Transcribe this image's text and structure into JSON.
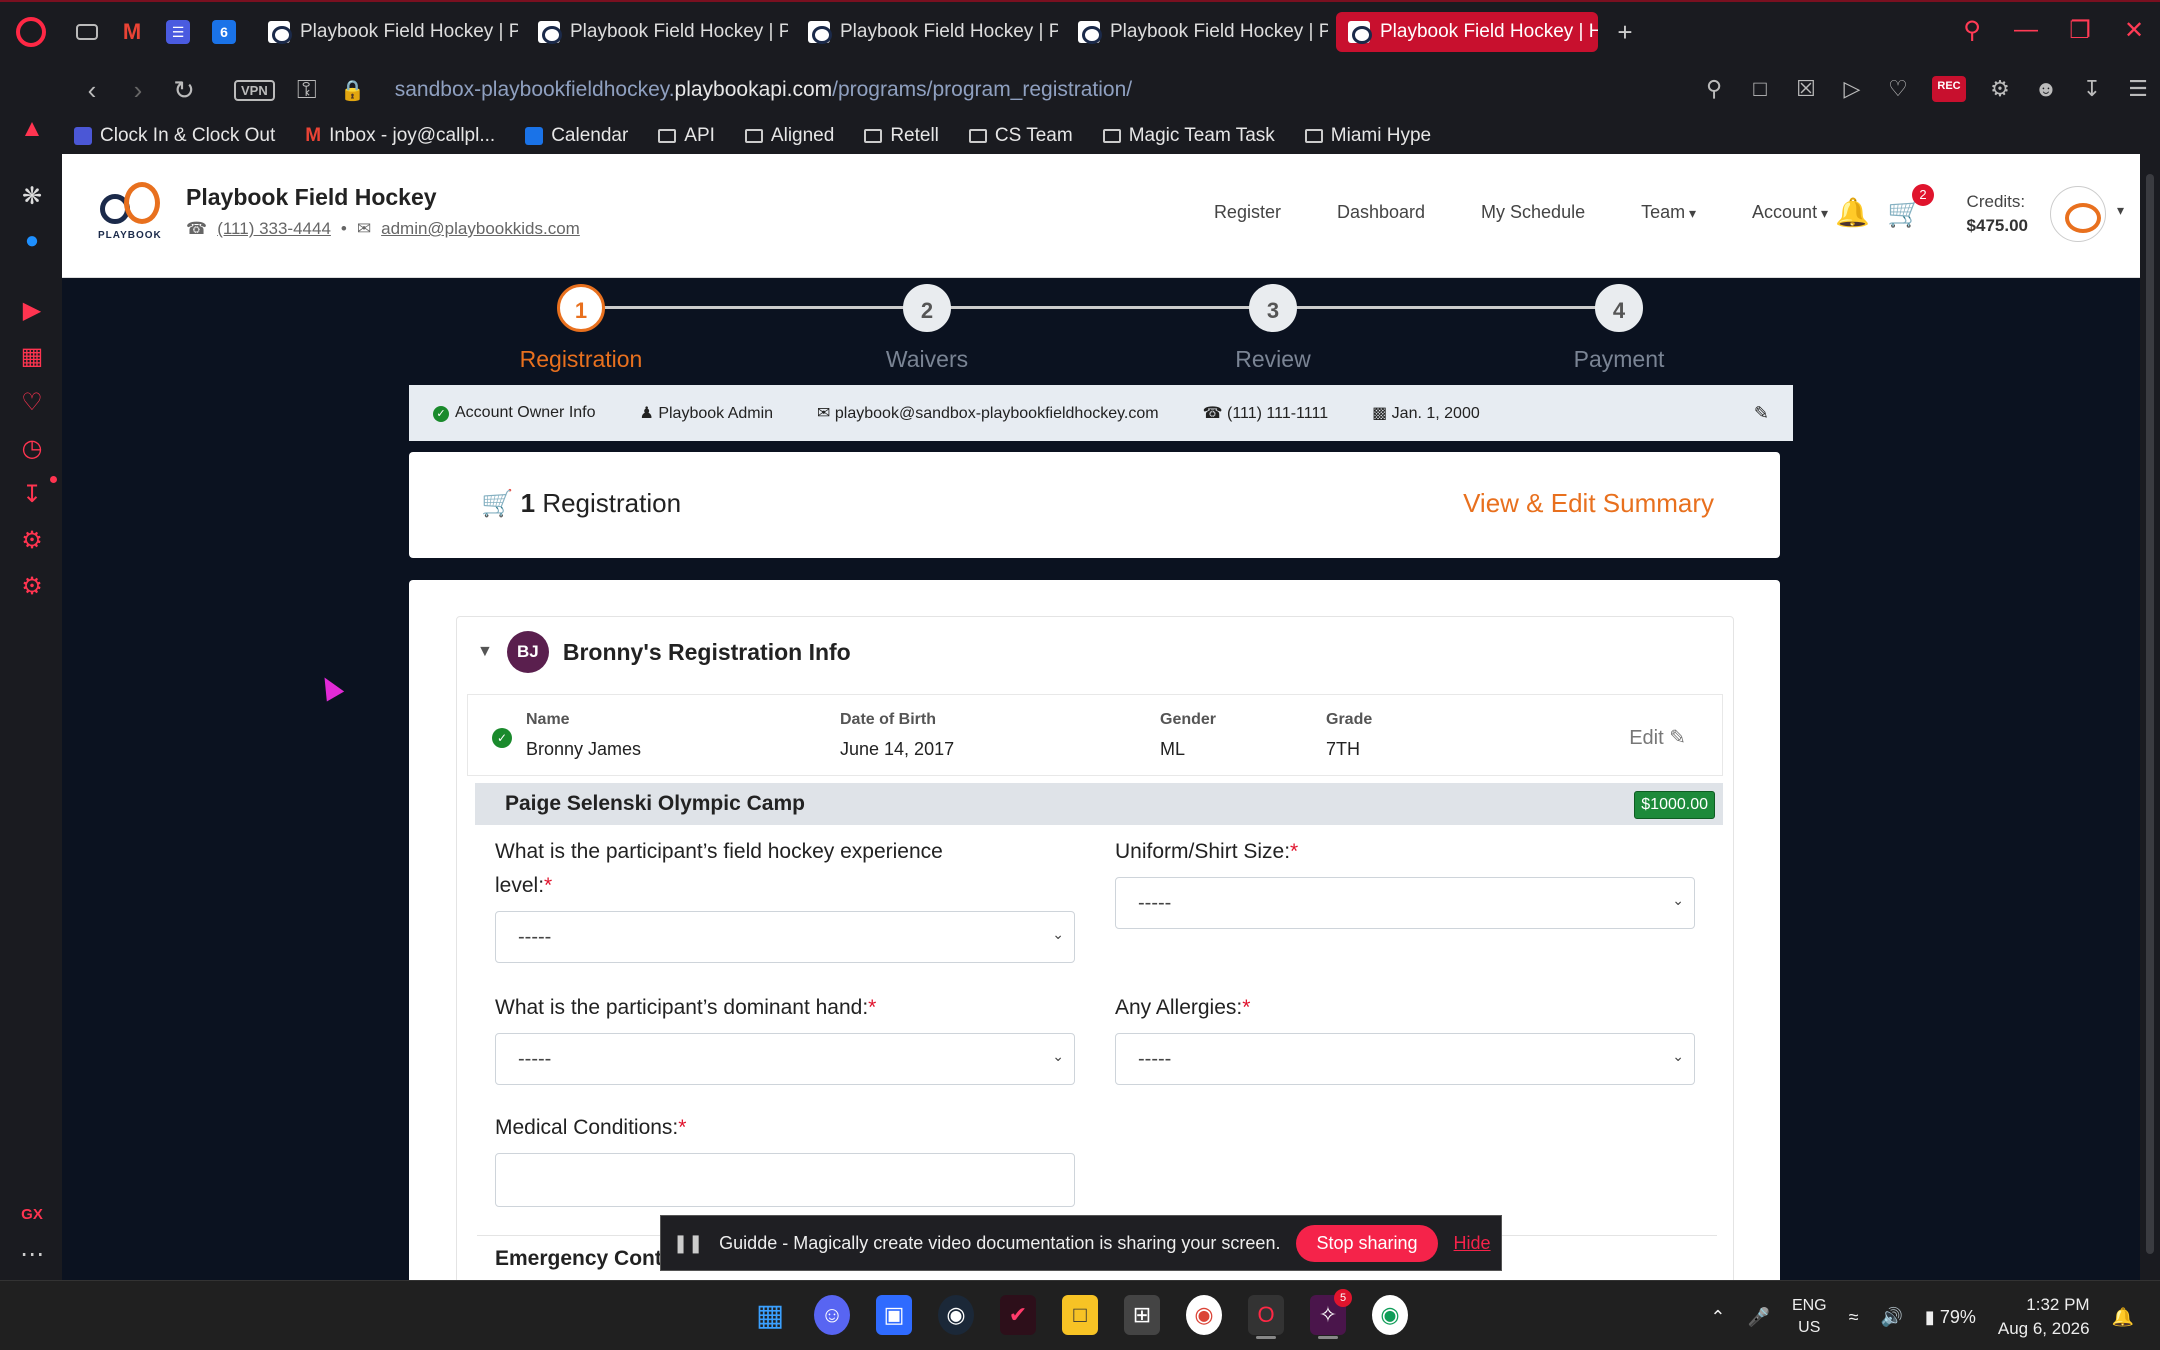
{
  "browser": {
    "tabs": [
      {
        "title": "Playbook Field Hockey | Pla"
      },
      {
        "title": "Playbook Field Hockey | Pl"
      },
      {
        "title": "Playbook Field Hockey | Pl"
      },
      {
        "title": "Playbook Field Hockey | Pl"
      },
      {
        "title": "Playbook Field Hockey | Ho"
      }
    ],
    "vpn_label": "VPN",
    "url_prefix": "sandbox-playbookfieldhockey.",
    "url_domain": "playbookapi.com",
    "url_path": "/programs/program_registration/",
    "rec_label": "REC",
    "bookmarks": [
      {
        "label": "Clock In & Clock Out"
      },
      {
        "label": "Inbox - joy@callpl..."
      },
      {
        "label": "Calendar"
      },
      {
        "label": "API"
      },
      {
        "label": "Aligned"
      },
      {
        "label": "Retell"
      },
      {
        "label": "CS Team"
      },
      {
        "label": "Magic Team Task"
      },
      {
        "label": "Miami Hype"
      }
    ],
    "sidebar_gx": "GX"
  },
  "site": {
    "org_name": "Playbook Field Hockey",
    "phone": "(111) 333-4444",
    "email": "admin@playbookkids.com",
    "logo_text": "PLAYBOOK",
    "nav": {
      "register": "Register",
      "dashboard": "Dashboard",
      "schedule": "My Schedule",
      "team": "Team",
      "account": "Account"
    },
    "cart_count": "2",
    "credits_label": "Credits:",
    "credits_amount": "$475.00"
  },
  "stepper": [
    {
      "num": "1",
      "label": "Registration",
      "active": true
    },
    {
      "num": "2",
      "label": "Waivers"
    },
    {
      "num": "3",
      "label": "Review"
    },
    {
      "num": "4",
      "label": "Payment"
    }
  ],
  "owner": {
    "section": "Account Owner Info",
    "name": "Playbook Admin",
    "email": "playbook@sandbox-playbookfieldhockey.com",
    "phone": "(111) 111-1111",
    "dob": "Jan. 1, 2000"
  },
  "summary": {
    "count": "1",
    "label": "Registration",
    "link": "View & Edit Summary"
  },
  "registration": {
    "initials": "BJ",
    "title": "Bronny's Registration Info",
    "participant": {
      "name_label": "Name",
      "name": "Bronny James",
      "dob_label": "Date of Birth",
      "dob": "June 14, 2017",
      "gender_label": "Gender",
      "gender": "ML",
      "grade_label": "Grade",
      "grade": "7TH",
      "edit": "Edit"
    },
    "camp_name": "Paige Selenski Olympic Camp",
    "camp_price": "$1000.00",
    "fields": {
      "experience_line1": "What is the participant’s field hockey experience",
      "experience_line2": "level:",
      "uniform": "Uniform/Shirt Size:",
      "hand": "What is the participant’s dominant hand:",
      "allergies": "Any Allergies:",
      "medical": "Medical Conditions:",
      "emergency": "Emergency Contact",
      "required_mark": "*",
      "select_placeholder": "-----"
    }
  },
  "share_bar": {
    "message": "Guidde - Magically create video documentation is sharing your screen.",
    "stop": "Stop sharing",
    "hide": "Hide"
  },
  "taskbar": {
    "slack_badge": "5",
    "lang_line1": "ENG",
    "lang_line2": "US",
    "battery": "79%",
    "time": "1:32 PM",
    "date": "Aug 6, 2026"
  }
}
